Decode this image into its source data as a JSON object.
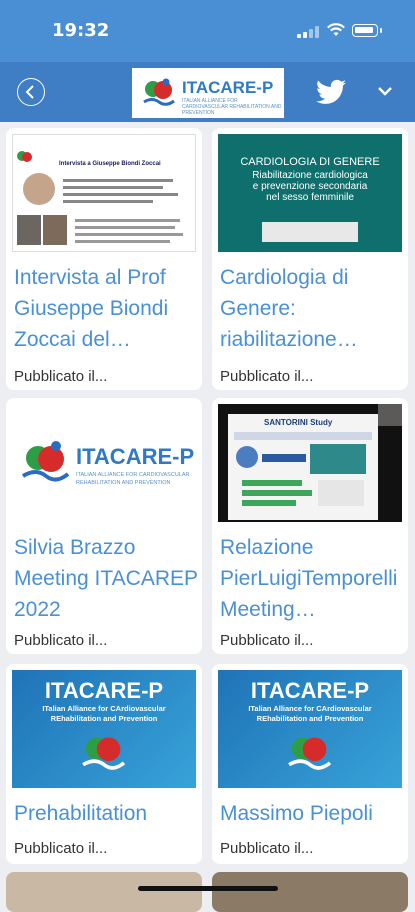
{
  "status": {
    "time": "19:32"
  },
  "header": {
    "logo_text": "ITACARE-P",
    "logo_sub": "ITALIAN ALLIANCE FOR CARDIOVASCULAR REHABILITATION AND PREVENTION"
  },
  "cards": [
    {
      "title": "Intervista al Prof Giuseppe Biondi Zoccai del…",
      "published": "Pubblicato il...",
      "thumb": {
        "kind": "doc",
        "heading": "Intervista a Giuseppe Biondi Zoccai",
        "names": "Giuseppe Biondi Zoccai · Luigi Spadafora"
      }
    },
    {
      "title": "Cardiologia di Genere: riabilitazione…",
      "published": "Pubblicato il...",
      "thumb": {
        "kind": "slide",
        "line1": "CARDIOLOGIA DI GENERE",
        "line2": "Riabilitazione cardiologica",
        "line3": "e prevenzione secondaria",
        "line4": "nel sesso femminile"
      }
    },
    {
      "title": "Silvia Brazzo Meeting ITACAREP 2022",
      "published": "Pubblicato il...",
      "thumb": {
        "kind": "logo",
        "brand": "ITACARE-P",
        "sub1": "ITALIAN ALLIANCE FOR CARDIOVASCULAR",
        "sub2": "REHABILITATION AND PREVENTION"
      }
    },
    {
      "title": "Relazione PierLuigiTemporelli Meeting…",
      "published": "Pubblicato il...",
      "thumb": {
        "kind": "video",
        "heading": "SANTORINI Study"
      }
    },
    {
      "title": "Prehabilitation",
      "published": "Pubblicato il...",
      "thumb": {
        "kind": "banner",
        "brand": "ITACARE-P",
        "sub1": "ITalian Alliance for CArdiovascular",
        "sub2": "REhabilitation and Prevention"
      }
    },
    {
      "title": "Massimo Piepoli",
      "published": "Pubblicato il...",
      "thumb": {
        "kind": "banner",
        "brand": "ITACARE-P",
        "sub1": "ITalian Alliance for CArdiovascular",
        "sub2": "REhabilitation and Prevention"
      }
    }
  ],
  "colors": {
    "accent": "#4a90d6",
    "appbar": "#3f7ec4",
    "statusbar": "#4a8fd3"
  }
}
